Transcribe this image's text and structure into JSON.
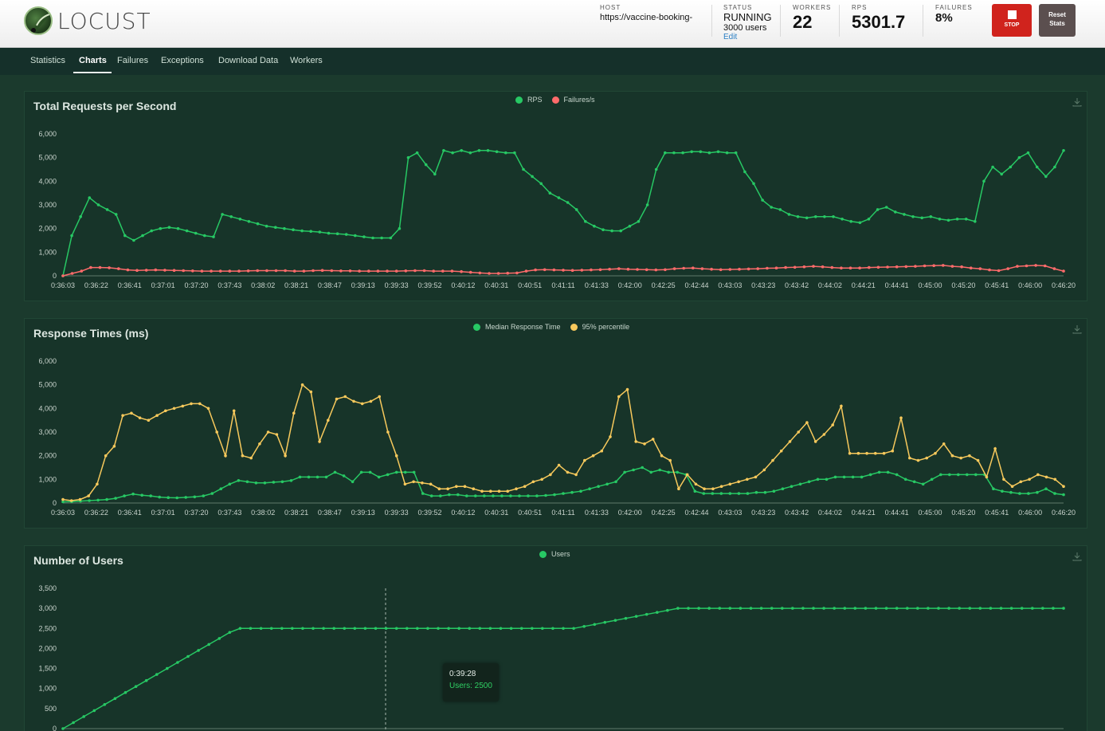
{
  "app": {
    "logo_text": "LOCUST"
  },
  "header": {
    "host": {
      "label": "HOST",
      "value": "https://vaccine-booking-"
    },
    "status": {
      "label": "STATUS",
      "value": "RUNNING",
      "users": "3000 users",
      "edit": "Edit"
    },
    "workers": {
      "label": "WORKERS",
      "value": "22"
    },
    "rps": {
      "label": "RPS",
      "value": "5301.7"
    },
    "failures": {
      "label": "FAILURES",
      "value": "8%"
    },
    "stop_label": "STOP",
    "reset_label_1": "Reset",
    "reset_label_2": "Stats"
  },
  "nav": {
    "tabs": [
      "Statistics",
      "Charts",
      "Failures",
      "Exceptions",
      "Download Data",
      "Workers"
    ],
    "active": "Charts"
  },
  "colors": {
    "green": "#27c864",
    "red": "#ff6b6b",
    "yellow": "#f7c95c"
  },
  "tooltip": {
    "time": "0:39:28",
    "text": "Users: 2500"
  },
  "chart_data": [
    {
      "type": "line",
      "title": "Total Requests per Second",
      "series_names": [
        "RPS",
        "Failures/s"
      ],
      "y_ticks": [
        "6,000",
        "5,000",
        "4,000",
        "3,000",
        "2,000",
        "1,000",
        "0"
      ],
      "ylim": [
        0,
        6000
      ],
      "x_ticks": [
        "0:36:03",
        "0:36:22",
        "0:36:41",
        "0:37:01",
        "0:37:20",
        "0:37:43",
        "0:38:02",
        "0:38:21",
        "0:38:47",
        "0:39:13",
        "0:39:33",
        "0:39:52",
        "0:40:12",
        "0:40:31",
        "0:40:51",
        "0:41:11",
        "0:41:33",
        "0:42:00",
        "0:42:25",
        "0:42:44",
        "0:43:03",
        "0:43:23",
        "0:43:42",
        "0:44:02",
        "0:44:21",
        "0:44:41",
        "0:45:00",
        "0:45:20",
        "0:45:41",
        "0:46:00",
        "0:46:20"
      ],
      "series": [
        {
          "name": "RPS",
          "values": [
            0,
            1700,
            2500,
            3300,
            3000,
            2800,
            2600,
            1700,
            1500,
            1700,
            1900,
            2000,
            2050,
            2000,
            1900,
            1800,
            1700,
            1650,
            2600,
            2500,
            2400,
            2300,
            2200,
            2100,
            2050,
            2000,
            1950,
            1900,
            1880,
            1850,
            1800,
            1780,
            1750,
            1700,
            1650,
            1600,
            1600,
            1600,
            2000,
            5000,
            5200,
            4700,
            4300,
            5300,
            5200,
            5300,
            5200,
            5300,
            5300,
            5250,
            5200,
            5200,
            4500,
            4200,
            3900,
            3500,
            3300,
            3100,
            2800,
            2300,
            2100,
            1950,
            1900,
            1900,
            2100,
            2300,
            3000,
            4500,
            5200,
            5200,
            5200,
            5250,
            5250,
            5200,
            5250,
            5200,
            5200,
            4400,
            3900,
            3200,
            2900,
            2800,
            2600,
            2500,
            2450,
            2500,
            2500,
            2500,
            2400,
            2300,
            2250,
            2400,
            2800,
            2900,
            2700,
            2600,
            2500,
            2450,
            2500,
            2400,
            2350,
            2400,
            2400,
            2300,
            4000,
            4600,
            4300,
            4600,
            5000,
            5200,
            4600,
            4200,
            4600,
            5300
          ]
        },
        {
          "name": "Failures/s",
          "values": [
            0,
            100,
            200,
            350,
            350,
            340,
            300,
            250,
            230,
            240,
            250,
            240,
            230,
            220,
            210,
            200,
            200,
            200,
            200,
            200,
            210,
            220,
            220,
            220,
            220,
            200,
            200,
            220,
            230,
            220,
            210,
            210,
            200,
            200,
            200,
            200,
            200,
            210,
            220,
            220,
            200,
            200,
            200,
            180,
            150,
            120,
            100,
            100,
            110,
            120,
            200,
            250,
            260,
            250,
            240,
            230,
            240,
            250,
            260,
            280,
            300,
            280,
            270,
            260,
            250,
            260,
            300,
            320,
            330,
            300,
            280,
            260,
            270,
            280,
            290,
            300,
            320,
            330,
            350,
            360,
            380,
            400,
            380,
            350,
            330,
            330,
            330,
            350,
            360,
            370,
            380,
            390,
            400,
            420,
            430,
            440,
            400,
            380,
            330,
            300,
            250,
            220,
            300,
            400,
            420,
            440,
            420,
            300,
            200
          ]
        }
      ]
    },
    {
      "type": "line",
      "title": "Response Times (ms)",
      "series_names": [
        "Median Response Time",
        "95% percentile"
      ],
      "y_ticks": [
        "6,000",
        "5,000",
        "4,000",
        "3,000",
        "2,000",
        "1,000",
        "0"
      ],
      "ylim": [
        0,
        6000
      ],
      "x_ticks": [
        "0:36:03",
        "0:36:22",
        "0:36:41",
        "0:37:01",
        "0:37:20",
        "0:37:43",
        "0:38:02",
        "0:38:21",
        "0:38:47",
        "0:39:13",
        "0:39:33",
        "0:39:52",
        "0:40:12",
        "0:40:31",
        "0:40:51",
        "0:41:11",
        "0:41:33",
        "0:42:00",
        "0:42:25",
        "0:42:44",
        "0:43:03",
        "0:43:23",
        "0:43:42",
        "0:44:02",
        "0:44:21",
        "0:44:41",
        "0:45:00",
        "0:45:20",
        "0:45:41",
        "0:46:00",
        "0:46:20"
      ],
      "series": [
        {
          "name": "Median Response Time",
          "values": [
            50,
            60,
            80,
            100,
            120,
            150,
            200,
            300,
            380,
            330,
            300,
            250,
            230,
            220,
            240,
            260,
            300,
            400,
            600,
            800,
            950,
            900,
            850,
            850,
            880,
            900,
            950,
            1100,
            1100,
            1100,
            1100,
            1300,
            1150,
            900,
            1300,
            1300,
            1100,
            1200,
            1300,
            1300,
            1300,
            400,
            300,
            300,
            350,
            350,
            300,
            300,
            300,
            300,
            300,
            300,
            300,
            300,
            300,
            320,
            350,
            400,
            450,
            500,
            600,
            700,
            800,
            900,
            1300,
            1400,
            1500,
            1300,
            1400,
            1300,
            1300,
            1200,
            500,
            400,
            400,
            400,
            400,
            400,
            400,
            450,
            450,
            500,
            600,
            700,
            800,
            900,
            1000,
            1000,
            1100,
            1100,
            1100,
            1100,
            1200,
            1300,
            1300,
            1200,
            1000,
            900,
            800,
            1000,
            1200,
            1200,
            1200,
            1200,
            1200,
            1200,
            600,
            500,
            450,
            400,
            400,
            450,
            600,
            400,
            350
          ]
        },
        {
          "name": "95% percentile",
          "values": [
            150,
            100,
            150,
            300,
            800,
            2000,
            2400,
            3700,
            3800,
            3600,
            3500,
            3700,
            3900,
            4000,
            4100,
            4200,
            4200,
            4000,
            3000,
            2000,
            3900,
            2000,
            1900,
            2500,
            3000,
            2900,
            2000,
            3800,
            5000,
            4700,
            2600,
            3500,
            4400,
            4500,
            4300,
            4200,
            4300,
            4500,
            3000,
            2000,
            800,
            900,
            850,
            800,
            600,
            600,
            700,
            700,
            600,
            500,
            500,
            500,
            500,
            600,
            700,
            900,
            1000,
            1200,
            1600,
            1300,
            1200,
            1800,
            2000,
            2200,
            2800,
            4500,
            4800,
            2600,
            2500,
            2700,
            2000,
            1800,
            600,
            1200,
            800,
            600,
            600,
            700,
            800,
            900,
            1000,
            1100,
            1400,
            1800,
            2200,
            2600,
            3000,
            3400,
            2600,
            2900,
            3300,
            4100,
            2100,
            2100,
            2100,
            2100,
            2100,
            2200,
            3600,
            1900,
            1800,
            1900,
            2100,
            2500,
            2000,
            1900,
            2000,
            1800,
            1100,
            2300,
            1000,
            700,
            900,
            1000,
            1200,
            1100,
            1000,
            700
          ]
        }
      ]
    },
    {
      "type": "line",
      "title": "Number of Users",
      "series_names": [
        "Users"
      ],
      "y_ticks": [
        "3,500",
        "3,000",
        "2,500",
        "2,000",
        "1,500",
        "1,000",
        "500",
        "0"
      ],
      "ylim": [
        0,
        3500
      ],
      "series": [
        {
          "name": "Users",
          "values": [
            0,
            150,
            300,
            450,
            600,
            750,
            900,
            1050,
            1200,
            1350,
            1500,
            1650,
            1800,
            1950,
            2100,
            2250,
            2400,
            2500,
            2500,
            2500,
            2500,
            2500,
            2500,
            2500,
            2500,
            2500,
            2500,
            2500,
            2500,
            2500,
            2500,
            2500,
            2500,
            2500,
            2500,
            2500,
            2500,
            2500,
            2500,
            2500,
            2500,
            2500,
            2500,
            2500,
            2500,
            2500,
            2500,
            2500,
            2500,
            2500,
            2550,
            2600,
            2650,
            2700,
            2750,
            2800,
            2850,
            2900,
            2950,
            3000,
            3000,
            3000,
            3000,
            3000,
            3000,
            3000,
            3000,
            3000,
            3000,
            3000,
            3000,
            3000,
            3000,
            3000,
            3000,
            3000,
            3000,
            3000,
            3000,
            3000,
            3000,
            3000,
            3000,
            3000,
            3000,
            3000,
            3000,
            3000,
            3000,
            3000,
            3000,
            3000,
            3000,
            3000,
            3000,
            3000,
            3000
          ]
        }
      ]
    }
  ]
}
